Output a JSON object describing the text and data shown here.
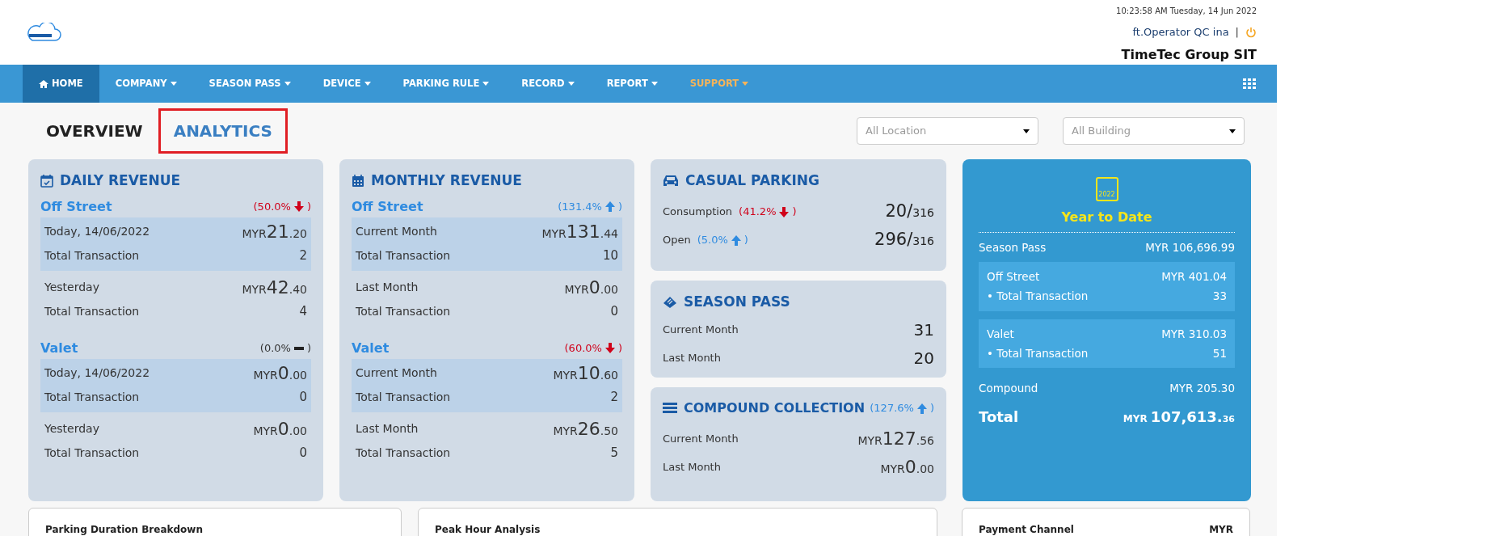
{
  "header": {
    "datetime": "10:23:58 AM Tuesday, 14 Jun 2022",
    "user": "ft.Operator QC ina",
    "separator": "|",
    "company": "TimeTec Group SIT"
  },
  "nav": [
    {
      "label": "HOME",
      "dropdown": false,
      "selected": true
    },
    {
      "label": "COMPANY",
      "dropdown": true,
      "selected": false
    },
    {
      "label": "SEASON PASS",
      "dropdown": true,
      "selected": false
    },
    {
      "label": "DEVICE",
      "dropdown": true,
      "selected": false
    },
    {
      "label": "PARKING RULE",
      "dropdown": true,
      "selected": false
    },
    {
      "label": "RECORD",
      "dropdown": true,
      "selected": false
    },
    {
      "label": "REPORT",
      "dropdown": true,
      "selected": false
    },
    {
      "label": "SUPPORT",
      "dropdown": true,
      "selected": false,
      "color": "#f5b45a"
    }
  ],
  "tabs": [
    {
      "label": "OVERVIEW",
      "selected": false
    },
    {
      "label": "ANALYTICS",
      "selected": true
    }
  ],
  "filters": [
    {
      "placeholder": "All Location"
    },
    {
      "placeholder": "All Building"
    }
  ],
  "revenue_cards": [
    {
      "title": "DAILY REVENUE",
      "sections": [
        {
          "title": "Off Street",
          "trend": {
            "open": "(50.0%",
            "close": ")",
            "kind": "down"
          },
          "groups": [
            {
              "highlighted": true,
              "rows": [
                {
                  "label": "Today, 14/06/2022",
                  "kind": "money",
                  "currency": "MYR",
                  "whole": "21",
                  "cents": ".20"
                },
                {
                  "label": "Total Transaction",
                  "kind": "count",
                  "value": "2"
                }
              ]
            },
            {
              "highlighted": false,
              "rows": [
                {
                  "label": "Yesterday",
                  "kind": "money",
                  "currency": "MYR",
                  "whole": "42",
                  "cents": ".40"
                },
                {
                  "label": "Total Transaction",
                  "kind": "count",
                  "value": "4"
                }
              ]
            }
          ]
        },
        {
          "title": "Valet",
          "trend": {
            "open": "(0.0%",
            "close": ")",
            "kind": "flat"
          },
          "groups": [
            {
              "highlighted": true,
              "rows": [
                {
                  "label": "Today, 14/06/2022",
                  "kind": "money",
                  "currency": "MYR",
                  "whole": "0",
                  "cents": ".00"
                },
                {
                  "label": "Total Transaction",
                  "kind": "count",
                  "value": "0"
                }
              ]
            },
            {
              "highlighted": false,
              "rows": [
                {
                  "label": "Yesterday",
                  "kind": "money",
                  "currency": "MYR",
                  "whole": "0",
                  "cents": ".00"
                },
                {
                  "label": "Total Transaction",
                  "kind": "count",
                  "value": "0"
                }
              ]
            }
          ]
        }
      ]
    },
    {
      "title": "MONTHLY REVENUE",
      "sections": [
        {
          "title": "Off Street",
          "trend": {
            "open": "(131.4%",
            "close": ")",
            "kind": "up"
          },
          "groups": [
            {
              "highlighted": true,
              "rows": [
                {
                  "label": "Current Month",
                  "kind": "money",
                  "currency": "MYR",
                  "whole": "131",
                  "cents": ".44"
                },
                {
                  "label": "Total Transaction",
                  "kind": "count",
                  "value": "10"
                }
              ]
            },
            {
              "highlighted": false,
              "rows": [
                {
                  "label": "Last Month",
                  "kind": "money",
                  "currency": "MYR",
                  "whole": "0",
                  "cents": ".00"
                },
                {
                  "label": "Total Transaction",
                  "kind": "count",
                  "value": "0"
                }
              ]
            }
          ]
        },
        {
          "title": "Valet",
          "trend": {
            "open": "(60.0%",
            "close": ")",
            "kind": "down"
          },
          "groups": [
            {
              "highlighted": true,
              "rows": [
                {
                  "label": "Current Month",
                  "kind": "money",
                  "currency": "MYR",
                  "whole": "10",
                  "cents": ".60"
                },
                {
                  "label": "Total Transaction",
                  "kind": "count",
                  "value": "2"
                }
              ]
            },
            {
              "highlighted": false,
              "rows": [
                {
                  "label": "Last Month",
                  "kind": "money",
                  "currency": "MYR",
                  "whole": "26",
                  "cents": ".50"
                },
                {
                  "label": "Total Transaction",
                  "kind": "count",
                  "value": "5"
                }
              ]
            }
          ]
        }
      ]
    }
  ],
  "casual_parking": {
    "title": "CASUAL PARKING",
    "rows": [
      {
        "label": "Consumption",
        "trend": {
          "open": "(41.2%",
          "close": ")",
          "kind": "down"
        },
        "big": "20/",
        "small": "316"
      },
      {
        "label": "Open",
        "trend": {
          "open": "(5.0%",
          "close": ")",
          "kind": "up"
        },
        "big": "296/",
        "small": "316"
      }
    ]
  },
  "season_pass": {
    "title": "SEASON PASS",
    "rows": [
      {
        "label": "Current Month",
        "value": "31"
      },
      {
        "label": "Last Month",
        "value": "20"
      }
    ]
  },
  "compound_collection": {
    "title": "COMPOUND COLLECTION",
    "trend": {
      "open": "(127.6%",
      "close": ")",
      "kind": "up"
    },
    "rows": [
      {
        "label": "Current Month",
        "currency": "MYR",
        "whole": "127",
        "cents": ".56"
      },
      {
        "label": "Last Month",
        "currency": "MYR",
        "whole": "0",
        "cents": ".00"
      }
    ]
  },
  "year_to_date": {
    "icon_year": "2022",
    "title": "Year to Date",
    "season_pass": {
      "label": "Season Pass",
      "value": "MYR 106,696.99"
    },
    "boxes": [
      {
        "label": "Off Street",
        "value": "MYR 401.04",
        "sub_label": "• Total Transaction",
        "sub_value": "33"
      },
      {
        "label": "Valet",
        "value": "MYR 310.03",
        "sub_label": "• Total Transaction",
        "sub_value": "51"
      }
    ],
    "compound": {
      "label": "Compound",
      "value": "MYR 205.30"
    },
    "total": {
      "label": "Total",
      "currency": "MYR",
      "whole": "107,613.",
      "cents": "36"
    }
  },
  "bottom_panels": [
    {
      "title": "Parking Duration Breakdown"
    },
    {
      "title": "Peak Hour Analysis"
    },
    {
      "title": "Payment Channel",
      "unit": "MYR"
    }
  ]
}
